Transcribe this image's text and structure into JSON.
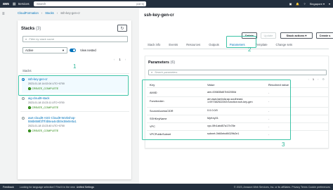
{
  "topnav": {
    "logo": "aws",
    "services": "Services",
    "search_placeholder": "Search",
    "shortcut": "[Alt+S]",
    "region": "Singapore ▾",
    "account": "▾"
  },
  "breadcrumb": [
    "CloudFormation",
    "Stacks",
    "ssh-key-gen-cr"
  ],
  "left": {
    "title": "Stacks",
    "count": "(3)",
    "search_placeholder": "Filter by stack name",
    "filter_value": "Active",
    "view_nested": "View nested",
    "page": "1",
    "column": "Stacks",
    "stacks": [
      {
        "name": "ssh-key-gen-cr",
        "date": "2023-01-18 14:02:04 UTC+0700",
        "status": "CREATE_COMPLETE",
        "selected": true
      },
      {
        "name": "aig-cloud9-stack",
        "date": "2023-01-18 13:23:11 UTC+0700",
        "status": "CREATE_COMPLETE",
        "selected": false
      },
      {
        "name": "aws-cloud9-ASG-Cloud9-Workshop-",
        "name2": "556b656f2f7f4b5ea4e3b0e38e0e0a1",
        "date": "2023-01-18 13:23:40 UTC+0700",
        "status": "CREATE_COMPLETE",
        "selected": false
      }
    ]
  },
  "right": {
    "title": "ssh-key-gen-cr",
    "buttons": {
      "delete": "Delete",
      "update": "Update",
      "stack_actions": "Stack actions ▾",
      "create_stack": "Create s"
    },
    "tabs": [
      "Stack info",
      "Events",
      "Resources",
      "Outputs",
      "Parameters",
      "Template",
      "Change sets"
    ],
    "active_tab": "Parameters",
    "params": {
      "title": "Parameters",
      "count": "(6)",
      "search_placeholder": "Search parameters",
      "page": "1",
      "headers": [
        "Key",
        "Value",
        "Resolved value"
      ],
      "rows": [
        {
          "key": "AMIID",
          "value": "ami-005835d57b52050d",
          "resolved": "-"
        },
        {
          "key": "FunctionArn",
          "value": "arn:aws:lambda:ap-southeast-1:097382522263:function:ssh-key-gen",
          "resolved": "-"
        },
        {
          "key": "SourceAccessCIDR",
          "value": "0.0.0.0/0",
          "resolved": "-"
        },
        {
          "key": "SSHKeyName",
          "value": "MyKey01",
          "resolved": "-"
        },
        {
          "key": "VPC",
          "value": "vpc-0fb1abd57a17b78e",
          "resolved": "-"
        },
        {
          "key": "VPCPublicSubnet",
          "value": "subnet-0b60ebdf4029b2e1",
          "resolved": "-"
        }
      ]
    }
  },
  "annotations": {
    "one": "1",
    "two": "2",
    "three": "3"
  },
  "footer": {
    "feedback": "Feedback",
    "language": "Looking for language selection? Find it in the new",
    "unified": "Unified Settings",
    "copyright": "© 2023, Amazon Web Services, Inc. or its affiliates.   Privacy   Terms   Cookie preferences"
  },
  "colors": {
    "accent": "#0073bb",
    "success": "#1d8102",
    "highlight": "#3cc3a6",
    "nav": "#232f3e"
  }
}
